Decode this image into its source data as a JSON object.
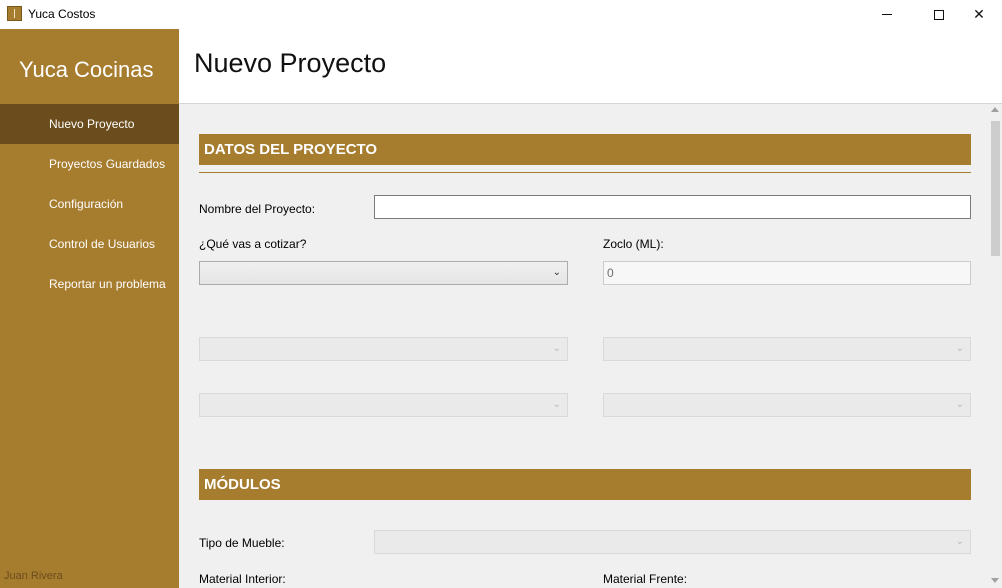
{
  "window": {
    "title": "Yuca Costos"
  },
  "sidebar": {
    "brand": "Yuca Cocinas",
    "items": [
      {
        "label": "Nuevo Proyecto"
      },
      {
        "label": "Proyectos Guardados"
      },
      {
        "label": "Configuración"
      },
      {
        "label": "Control de Usuarios"
      },
      {
        "label": "Reportar un problema"
      }
    ],
    "active_index": 0,
    "user": "Juan Rivera"
  },
  "header": {
    "title": "Nuevo Proyecto"
  },
  "sections": {
    "datos": {
      "title": "DATOS DEL PROYECTO",
      "nombre_label": "Nombre del Proyecto:",
      "nombre_value": "",
      "cotizar_label": "¿Qué vas a cotizar?",
      "cotizar_value": "",
      "zoclo_label": "Zoclo (ML):",
      "zoclo_value": "0"
    },
    "modulos": {
      "title": "MÓDULOS",
      "tipo_label": "Tipo de Mueble:",
      "tipo_value": "",
      "material_interior_label": "Material Interior:",
      "material_frente_label": "Material Frente:"
    }
  },
  "icons": {
    "dropdown": "chevron-down-icon",
    "minimize": "minimize-icon",
    "maximize": "maximize-icon",
    "close": "close-icon"
  },
  "colors": {
    "brand": "#a67c2e",
    "nav_active": "#6b4d1d",
    "content_bg": "#f0f0f0"
  }
}
